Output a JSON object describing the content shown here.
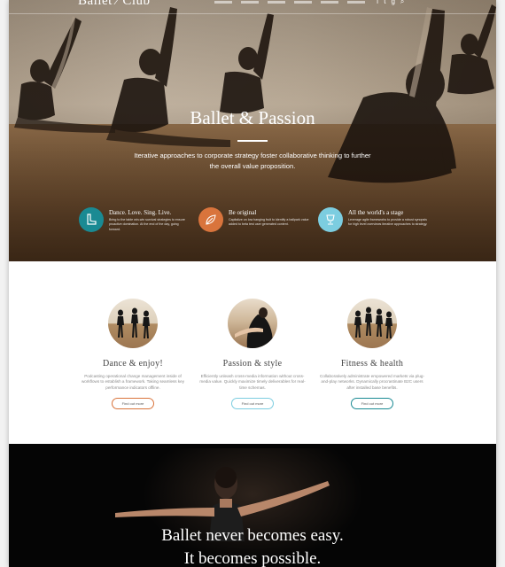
{
  "brand": {
    "logo_text": "Ballet",
    "logo_text_2": "Club"
  },
  "nav": {
    "icon_names": [
      "facebook-icon",
      "twitter-icon",
      "google-icon",
      "search-icon"
    ]
  },
  "hero": {
    "title": "Ballet & Passion",
    "subtitle": "Iterative approaches to corporate strategy foster collaborative thinking to further the overall value proposition.",
    "features": [
      {
        "icon": "boot-icon",
        "color": "#1a8a93",
        "title": "Dance. Love. Sing. Live.",
        "text": "Bring to the table win-win survival strategies to ensure proactive domination. At the end of the day, going forward."
      },
      {
        "icon": "leaf-icon",
        "color": "#d9743c",
        "title": "Be original",
        "text": "Capitalize on low hanging fruit to identify a ballpark value added to beta test user generated content."
      },
      {
        "icon": "trophy-icon",
        "color": "#7ccde0",
        "title": "All the world's a stage",
        "text": "Leverage agile frameworks to provide a robust synopsis for high level overviews iterative approaches to strategy."
      }
    ]
  },
  "services": [
    {
      "title": "Dance & enjoy!",
      "text": "Podcasting operational change management inside of workflows to establish a framework. Taking seamless key performance indicators offline.",
      "button": "Find out more",
      "button_color": "#d9743c"
    },
    {
      "title": "Passion & style",
      "text": "Efficiently unleash cross-media information without cross-media value. Quickly maximize timely deliverables for real-time schemas.",
      "button": "Find out more",
      "button_color": "#7ccde0"
    },
    {
      "title": "Fitness & health",
      "text": "Collaboratively administrate empowered markets via plug-and-play networks. Dynamically procrastinate B2C users after installed base benefits.",
      "button": "Find out more",
      "button_color": "#1a8a93"
    }
  ],
  "quote": {
    "line1": "Ballet never becomes easy.",
    "line2": "It becomes possible."
  }
}
